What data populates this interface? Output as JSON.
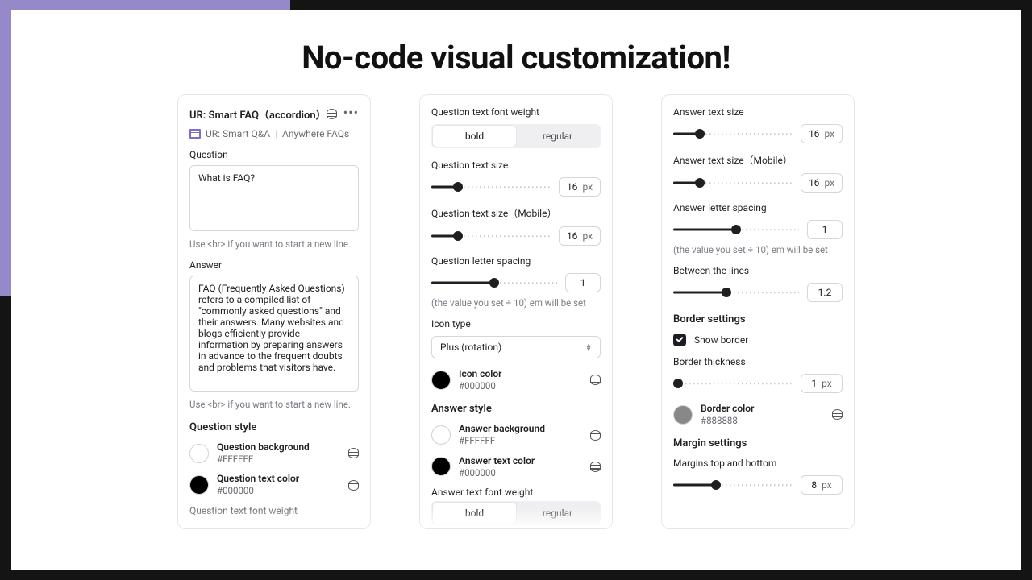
{
  "hero": {
    "title": "No-code visual customization!"
  },
  "left": {
    "title": "UR: Smart FAQ（accordion）",
    "crumb_a": "UR: Smart Q&A",
    "crumb_b": "Anywhere FAQs",
    "question_label": "Question",
    "question_value": "What is FAQ?",
    "question_help": "Use <br> if you want to start a new line.",
    "answer_label": "Answer",
    "answer_value": "FAQ (Frequently Asked Questions) refers to a compiled list of \"commonly asked questions\" and their answers. Many websites and blogs efficiently provide information by preparing answers in advance to the frequent doubts and problems that visitors have.",
    "answer_help": "Use <br> if you want to start a new line.",
    "style_heading": "Question style",
    "q_bg": {
      "name": "Question background",
      "hex": "#FFFFFF",
      "color": "#ffffff"
    },
    "q_tc": {
      "name": "Question text color",
      "hex": "#000000",
      "color": "#000000"
    },
    "peek": "Question text font weight"
  },
  "mid": {
    "weight_label": "Question text font weight",
    "seg_bold": "bold",
    "seg_regular": "regular",
    "q_size_label": "Question text size",
    "q_size": "16",
    "px": "px",
    "q_size_m_label": "Question text size（Mobile）",
    "q_size_m": "16",
    "q_ls_label": "Question letter spacing",
    "q_ls": "1",
    "ls_help": "(the value you set ÷ 10) em will be set",
    "icon_type_label": "Icon type",
    "icon_type": "Plus (rotation)",
    "icon_color": {
      "name": "Icon color",
      "hex": "#000000",
      "color": "#000000"
    },
    "answer_style_heading": "Answer style",
    "a_bg": {
      "name": "Answer background",
      "hex": "#FFFFFF",
      "color": "#ffffff"
    },
    "a_tc": {
      "name": "Answer text color",
      "hex": "#000000",
      "color": "#000000"
    },
    "a_weight_label": "Answer text font weight"
  },
  "right": {
    "a_size_label": "Answer text size",
    "a_size": "16",
    "px": "px",
    "a_size_m_label": "Answer text size（Mobile）",
    "a_size_m": "16",
    "a_ls_label": "Answer letter spacing",
    "a_ls": "1",
    "ls_help": "(the value you set ÷ 10) em will be set",
    "lh_label": "Between the lines",
    "lh": "1.2",
    "border_heading": "Border settings",
    "show_border": "Show border",
    "thickness_label": "Border thickness",
    "thickness": "1",
    "border_color": {
      "name": "Border color",
      "hex": "#888888",
      "color": "#888888"
    },
    "margin_heading": "Margin settings",
    "margin_label": "Margins top and bottom",
    "margin": "8"
  },
  "seg": {
    "bold": "bold",
    "regular": "regular"
  }
}
